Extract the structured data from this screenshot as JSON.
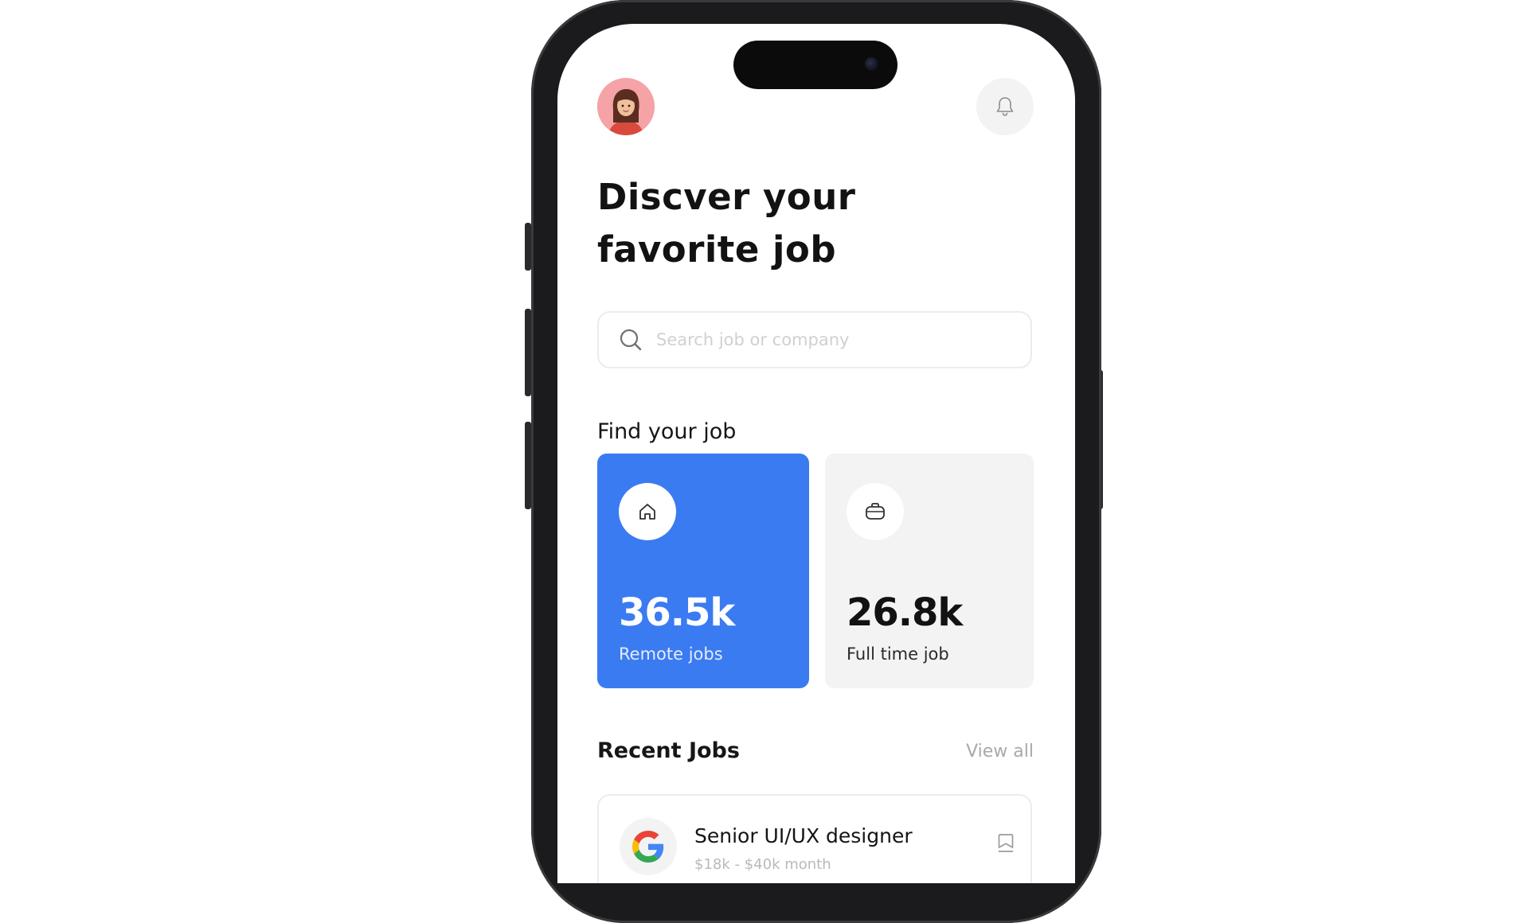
{
  "header": {
    "hero_title_line1": "Discver your",
    "hero_title_line2": "favorite job"
  },
  "search": {
    "placeholder": "Search job or company",
    "value": ""
  },
  "find_section": {
    "title": "Find your job",
    "cards": [
      {
        "value": "36.5k",
        "label": "Remote jobs",
        "icon": "home-icon",
        "background": "#3a7bf2"
      },
      {
        "value": "26.8k",
        "label": "Full time job",
        "icon": "briefcase-icon",
        "background": "#f3f3f4"
      }
    ]
  },
  "recent_section": {
    "title": "Recent Jobs",
    "view_all_label": "View all",
    "jobs": [
      {
        "title": "Senior UI/UX designer",
        "salary": "$18k - $40k month",
        "company_logo": "google-logo-icon"
      }
    ]
  },
  "icons": {
    "notification": "bell-icon",
    "search": "search-icon",
    "bookmark": "bookmark-icon",
    "avatar": "avatar-icon"
  },
  "colors": {
    "accent": "#3a7bf2",
    "card_muted": "#f3f3f4",
    "avatar_bg": "#f5a3a6",
    "placeholder": "#d0d0d4"
  }
}
